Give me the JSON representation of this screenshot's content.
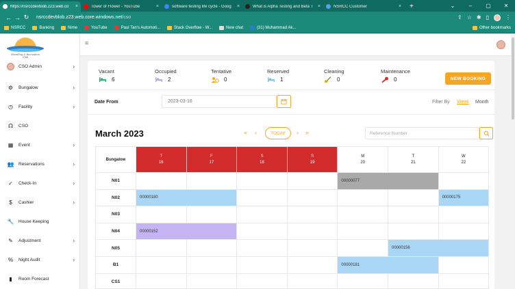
{
  "browser": {
    "tabs": [
      {
        "title": "https://nsrccdevblob.z23.web.co",
        "favicon_color": "#ffffff",
        "active": true
      },
      {
        "title": "Tower of Flower - YouTube",
        "favicon_color": "#ff0000",
        "active": false
      },
      {
        "title": "software testing life cycle - Goog",
        "favicon_color": "#4285f4",
        "active": false
      },
      {
        "title": "What is Alpha Testing and Beta T",
        "favicon_color": "#222222",
        "active": false
      },
      {
        "title": "NSRCC Customer",
        "favicon_color": "#5aa0e6",
        "active": false
      }
    ],
    "new_tab": "+",
    "url_host": "nsrccdevblob.z23.web.core.windows.net",
    "url_path": "/cso",
    "bookmarks": [
      {
        "label": "NSRCC",
        "icon": "folder-icon"
      },
      {
        "label": "Banking",
        "icon": "folder-icon"
      },
      {
        "label": "Nime",
        "icon": "folder-icon"
      },
      {
        "label": "YouTube",
        "icon": "youtube-icon"
      },
      {
        "label": "Paul Tan's Automoti...",
        "icon": "p-icon"
      },
      {
        "label": "Stack Overflow - W...",
        "icon": "folder-icon"
      },
      {
        "label": "New chat",
        "icon": "chat-icon"
      },
      {
        "label": "(31) Muhammad Ak...",
        "icon": "linkedin-icon"
      }
    ],
    "other_bookmarks": "Other bookmarks"
  },
  "sidebar": {
    "logo_tagline": "Marsiling & Recreation Club",
    "admin_label": "CSO Admin",
    "items": [
      {
        "label": "Bungalow",
        "icon": "gear-icon",
        "chevron": true
      },
      {
        "label": "Facility",
        "icon": "clock-icon",
        "chevron": true
      },
      {
        "label": "CSO",
        "icon": "headset-icon",
        "chevron": false
      },
      {
        "label": "Event",
        "icon": "calendar-icon",
        "chevron": true
      },
      {
        "label": "Reservations",
        "icon": "users-icon",
        "chevron": true
      },
      {
        "label": "Check-In",
        "icon": "check-circle-icon",
        "chevron": true
      },
      {
        "label": "Cashier",
        "icon": "dollar-icon",
        "chevron": true
      },
      {
        "label": "House Keeping",
        "icon": "wrench-icon",
        "chevron": false
      },
      {
        "label": "Adjustment",
        "icon": "pencil-icon",
        "chevron": true
      },
      {
        "label": "Night Audit",
        "icon": "percent-icon",
        "chevron": true
      },
      {
        "label": "Room Forecast",
        "icon": "bar-chart-icon",
        "chevron": false
      }
    ]
  },
  "stats": [
    {
      "label": "Vacant",
      "value": "6",
      "icon": "bed-icon",
      "color": "#2bb673"
    },
    {
      "label": "Occupied",
      "value": "2",
      "icon": "bed-icon",
      "color": "#b8a7ea"
    },
    {
      "label": "Tentative",
      "value": "0",
      "icon": "user-clock-icon",
      "color": "#f5a623"
    },
    {
      "label": "Reserved",
      "value": "1",
      "icon": "bed-icon",
      "color": "#7cc4f0"
    },
    {
      "label": "Cleaning",
      "value": "0",
      "icon": "broom-icon",
      "color": "#c8b400"
    },
    {
      "label": "Maintenance",
      "value": "0",
      "icon": "wrench-icon",
      "color": "#d22b2b"
    }
  ],
  "new_booking_label": "NEW BOOKING",
  "filter": {
    "date_from_label": "Date From",
    "date_from_value": "2023-03-16",
    "filter_by_label": "Filter By",
    "week_label": "Week",
    "month_label": "Month"
  },
  "calendar": {
    "title": "March 2023",
    "today_label": "TODAY",
    "reference_placeholder": "Reference Number",
    "corner_label": "Bungalow",
    "days": [
      {
        "dow": "T",
        "date": "16",
        "highlight": true
      },
      {
        "dow": "F",
        "date": "17",
        "highlight": true
      },
      {
        "dow": "S",
        "date": "18",
        "highlight": true
      },
      {
        "dow": "S",
        "date": "19",
        "highlight": true
      },
      {
        "dow": "M",
        "date": "20",
        "highlight": false
      },
      {
        "dow": "T",
        "date": "21",
        "highlight": false
      },
      {
        "dow": "W",
        "date": "22",
        "highlight": false
      }
    ],
    "rows": [
      "N01",
      "N02",
      "N03",
      "N04",
      "N05",
      "B1",
      "CS1"
    ],
    "bookings": [
      {
        "ref": "00000077",
        "row": 0,
        "start": 4,
        "span": 2,
        "color": "gray"
      },
      {
        "ref": "00000180",
        "row": 1,
        "start": 0,
        "span": 2,
        "color": "blue"
      },
      {
        "ref": "00000175",
        "row": 1,
        "start": 6,
        "span": 1,
        "color": "blue"
      },
      {
        "ref": "00000152",
        "row": 3,
        "start": 0,
        "span": 2,
        "color": "purple"
      },
      {
        "ref": "00000156",
        "row": 4,
        "start": 5,
        "span": 2,
        "color": "blue"
      },
      {
        "ref": "00000181",
        "row": 5,
        "start": 4,
        "span": 2,
        "color": "blue"
      }
    ]
  }
}
